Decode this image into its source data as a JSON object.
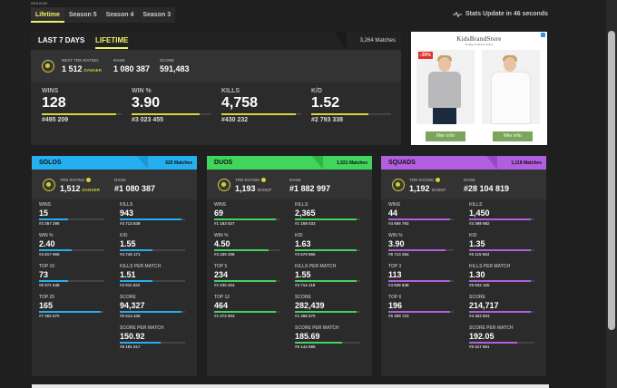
{
  "season": {
    "label": "SEASON",
    "tabs": [
      "Lifetime",
      "Season 5",
      "Season 4",
      "Season 3"
    ],
    "active_index": 0,
    "stats_update": "Stats Update in 46 seconds"
  },
  "overview": {
    "tabs": [
      "LAST 7 DAYS",
      "LIFETIME"
    ],
    "matches": "3,264 Matches",
    "best_label": "BEST TRN RATING",
    "best_value": "1 512",
    "best_tag": "DANGER",
    "rank_label": "RANK",
    "rank_value": "1 080 387",
    "score_label": "SCORE",
    "score_value": "591,483",
    "stats": [
      {
        "label": "WINS",
        "value": "128",
        "rank": "#495 209",
        "fill": 0.93
      },
      {
        "label": "WIN %",
        "value": "3.90",
        "rank": "#3 023 455",
        "fill": 0.85
      },
      {
        "label": "KILLS",
        "value": "4,758",
        "rank": "#430 232",
        "fill": 0.93
      },
      {
        "label": "K/D",
        "value": "1.52",
        "rank": "#2 793 338",
        "fill": 0.72
      }
    ]
  },
  "ad": {
    "brand": "KidsBrandStore",
    "tagline": "Vintage Fashion Online",
    "sale_badge": "-30%",
    "button1": "Mer info",
    "button2": "Mer info"
  },
  "modes": [
    {
      "key": "solos",
      "name": "SOLOS",
      "matches": "625 Matches",
      "rating_label": "TRN RATING",
      "rating_value": "1,512",
      "rating_tag": "DANGER",
      "rank_label": "RANK",
      "rank_value": "#1 080 387",
      "stats": [
        {
          "label": "WINS",
          "value": "15",
          "rank": "#3 357 295",
          "fill": 0.45
        },
        {
          "label": "KILLS",
          "value": "943",
          "rank": "#4 713 849",
          "fill": 0.95
        },
        {
          "label": "WIN %",
          "value": "2.40",
          "rank": "#4 817 965",
          "fill": 0.5
        },
        {
          "label": "K/D",
          "value": "1.55",
          "rank": "#4 745 171",
          "fill": 0.5
        },
        {
          "label": "TOP 10",
          "value": "73",
          "rank": "#6 571 548",
          "fill": 0.45
        },
        {
          "label": "KILLS PER MATCH",
          "value": "1.51",
          "rank": "#4 911 622",
          "fill": 0.5
        },
        {
          "label": "TOP 25",
          "value": "165",
          "rank": "#7 362 670",
          "fill": 0.95
        },
        {
          "label": "SCORE",
          "value": "94,327",
          "rank": "#6 514 446",
          "fill": 0.95
        },
        {
          "label": "SCORE PER MATCH",
          "value": "150.92",
          "rank": "#8 181 517",
          "fill": 0.62
        }
      ]
    },
    {
      "key": "duos",
      "name": "DUOS",
      "matches": "1,521 Matches",
      "rating_label": "TRN RATING",
      "rating_value": "1,193",
      "rating_tag": "SCOUT",
      "rank_label": "RANK",
      "rank_value": "#1 882 997",
      "stats": [
        {
          "label": "WINS",
          "value": "69",
          "rank": "#1 183 527",
          "fill": 0.95
        },
        {
          "label": "KILLS",
          "value": "2,365",
          "rank": "#1 158 033",
          "fill": 0.95
        },
        {
          "label": "WIN %",
          "value": "4.50",
          "rank": "#3 439 308",
          "fill": 0.83
        },
        {
          "label": "K/D",
          "value": "1.63",
          "rank": "#3 679 865",
          "fill": 0.95
        },
        {
          "label": "TOP 5",
          "value": "234",
          "rank": "#1 030 404",
          "fill": 0.95
        },
        {
          "label": "KILLS PER MATCH",
          "value": "1.55",
          "rank": "#3 714 118",
          "fill": 0.95
        },
        {
          "label": "TOP 12",
          "value": "464",
          "rank": "#1 072 903",
          "fill": 0.95
        },
        {
          "label": "SCORE",
          "value": "282,439",
          "rank": "#1 268 570",
          "fill": 0.95
        },
        {
          "label": "SCORE PER MATCH",
          "value": "185.69",
          "rank": "#6 144 585",
          "fill": 0.72
        }
      ]
    },
    {
      "key": "squads",
      "name": "SQUADS",
      "matches": "1,118 Matches",
      "rating_label": "TRN RATING",
      "rating_value": "1,192",
      "rating_tag": "SCOUT",
      "rank_label": "RANK",
      "rank_value": "#28 104 819",
      "stats": [
        {
          "label": "WINS",
          "value": "44",
          "rank": "#4 655 793",
          "fill": 0.95
        },
        {
          "label": "KILLS",
          "value": "1,450",
          "rank": "#3 398 982",
          "fill": 0.95
        },
        {
          "label": "WIN %",
          "value": "3.90",
          "rank": "#8 713 284",
          "fill": 0.88
        },
        {
          "label": "K/D",
          "value": "1.35",
          "rank": "#6 115 563",
          "fill": 0.95
        },
        {
          "label": "TOP 3",
          "value": "113",
          "rank": "#4 836 848",
          "fill": 0.95
        },
        {
          "label": "KILLS PER MATCH",
          "value": "1.30",
          "rank": "#5 932 165",
          "fill": 0.95
        },
        {
          "label": "TOP 6",
          "value": "196",
          "rank": "#5 369 723",
          "fill": 0.95
        },
        {
          "label": "SCORE",
          "value": "214,717",
          "rank": "#4 463 804",
          "fill": 0.95
        },
        {
          "label": "SCORE PER MATCH",
          "value": "192.05",
          "rank": "#9 417 661",
          "fill": 0.73
        }
      ]
    }
  ]
}
